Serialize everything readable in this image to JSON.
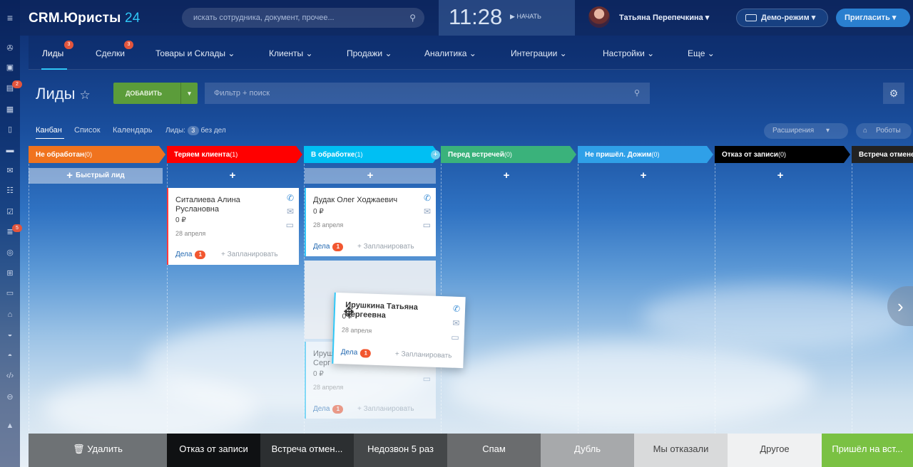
{
  "colors": {
    "accent": "#2fc6f6",
    "badge": "#e2553d",
    "add_button": "#5b9c3a"
  },
  "rail": {
    "badges": [
      "2",
      "5"
    ]
  },
  "header": {
    "logo_main": "CRM.Юристы",
    "logo_num": "24",
    "search_placeholder": "искать сотрудника, документ, прочее...",
    "time": "11:28",
    "start_label": "НАЧАТЬ",
    "user_name": "Татьяна Перепечкина",
    "demo_label": "Демо-режим",
    "invite_label": "Пригласить"
  },
  "nav": {
    "items": [
      {
        "label": "Лиды",
        "badge": "3"
      },
      {
        "label": "Сделки",
        "badge": "3"
      },
      {
        "label": "Товары и Склады ⌄"
      },
      {
        "label": "Клиенты ⌄"
      },
      {
        "label": "Продажи ⌄"
      },
      {
        "label": "Аналитика ⌄"
      },
      {
        "label": "Интеграции ⌄"
      },
      {
        "label": "Настройки ⌄"
      },
      {
        "label": "Еще ⌄"
      }
    ]
  },
  "page": {
    "title": "Лиды",
    "add_label": "ДОБАВИТЬ",
    "filter_placeholder": "Фильтр + поиск"
  },
  "views": {
    "kanban": "Канбан",
    "list": "Список",
    "calendar": "Календарь",
    "leads_label": "Лиды:",
    "leads_count": "3",
    "no_deals": "без дел",
    "extensions": "Расширения",
    "robots": "Роботы"
  },
  "stages": [
    {
      "name": "Не обработан",
      "count": "(0)",
      "color": "#f0731e"
    },
    {
      "name": "Теряем клиента",
      "count": "(1)",
      "color": "#ff0000"
    },
    {
      "name": "В обработке",
      "count": "(1)",
      "color": "#00bff3"
    },
    {
      "name": "Перед встречей",
      "count": "(0)",
      "color": "#3ab27b"
    },
    {
      "name": "Не пришёл. Дожим",
      "count": "(0)",
      "color": "#2fa0e8"
    },
    {
      "name": "Отказ от записи",
      "count": "(0)",
      "color": "#000000"
    },
    {
      "name": "Встреча отмене",
      "count": "",
      "color": "#222222"
    }
  ],
  "quick_lead": "Быстрый лид",
  "add_symbol": "+",
  "cards": [
    {
      "name": "Ситалиева Алина Руслановна",
      "sum": "0 ₽",
      "date": "28 апреля",
      "deals": "Дела",
      "deals_count": "1",
      "plan": "+ Запланировать"
    },
    {
      "name": "Дудак Олег Ходжаевич",
      "sum": "0 ₽",
      "date": "28 апреля",
      "deals": "Дела",
      "deals_count": "1",
      "plan": "+ Запланировать"
    },
    {
      "name": "Ирушкина Татьяна Сергеевна",
      "name_short1": "Ируш",
      "name_short2": "Серг",
      "sum": "0 ₽",
      "date": "28 апреля",
      "deals": "Дела",
      "deals_count": "1",
      "plan": "+ Запланировать"
    },
    {
      "name": "Ирушкина Татьяна Сергеевна",
      "sum": "0 ₽",
      "date": "28 апреля",
      "deals": "Дела",
      "deals_count": "1",
      "plan": "+ Запланировать"
    }
  ],
  "dropzones": [
    {
      "label": "Удалить",
      "bg": "#6e7275",
      "fg": "#ffffff"
    },
    {
      "label": "Отказ от записи",
      "bg": "#0f1113",
      "fg": "#ffffff"
    },
    {
      "label": "Встреча отмен...",
      "bg": "#2c2f31",
      "fg": "#ffffff"
    },
    {
      "label": "Недозвон 5 раз",
      "bg": "#444749",
      "fg": "#ffffff"
    },
    {
      "label": "Спам",
      "bg": "#6a6c6e",
      "fg": "#ffffff"
    },
    {
      "label": "Дубль",
      "bg": "#a7a9ab",
      "fg": "#ffffff"
    },
    {
      "label": "Мы отказали",
      "bg": "#d9dadb",
      "fg": "#444444"
    },
    {
      "label": "Другое",
      "bg": "#f0f1f2",
      "fg": "#444444"
    },
    {
      "label": "Пришёл на вст...",
      "bg": "#7ac143",
      "fg": "#ffffff"
    }
  ]
}
